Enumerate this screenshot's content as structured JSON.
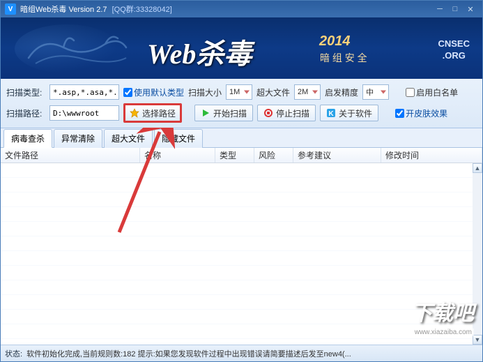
{
  "titlebar": {
    "logo": "V",
    "title": "暗组Web杀毒  Version 2.7",
    "qq": "[QQ群:33328042]"
  },
  "banner": {
    "brand": "Web杀毒",
    "year": "2014",
    "sub": "暗 组 安 全",
    "org1": "CNSEC",
    "org2": ".ORG"
  },
  "toolbar": {
    "row1": {
      "scan_type_label": "扫描类型:",
      "scan_type_value": "*.asp,*.asa,*.a:",
      "use_default_label": "使用默认类型",
      "scan_size_label": "扫描大小",
      "scan_size_value": "1M",
      "big_file_label": "超大文件",
      "big_file_value": "2M",
      "precision_label": "启发精度",
      "precision_value": "中",
      "whitelist_label": "启用白名单"
    },
    "row2": {
      "scan_path_label": "扫描路径:",
      "scan_path_value": "D:\\wwwroot",
      "choose_path": "选择路径",
      "start_scan": "开始扫描",
      "stop_scan": "停止扫描",
      "about": "关于软件",
      "skin_label": "开皮肤效果"
    }
  },
  "tabs": {
    "t1": "病毒查杀",
    "t2": "异常清除",
    "t3": "超大文件",
    "t4": "隐藏文件"
  },
  "columns": {
    "c1": "文件路径",
    "c2": "名称",
    "c3": "类型",
    "c4": "风险",
    "c5": "参考建议",
    "c6": "修改时间"
  },
  "status": {
    "label": "状态:",
    "text": "软件初始化完成,当前规则数:182 提示:如果您发现软件过程中出现错误请简要描述后发至new4(..."
  },
  "watermark": {
    "brand": "下载吧",
    "url": "www.xiazaiba.com"
  }
}
